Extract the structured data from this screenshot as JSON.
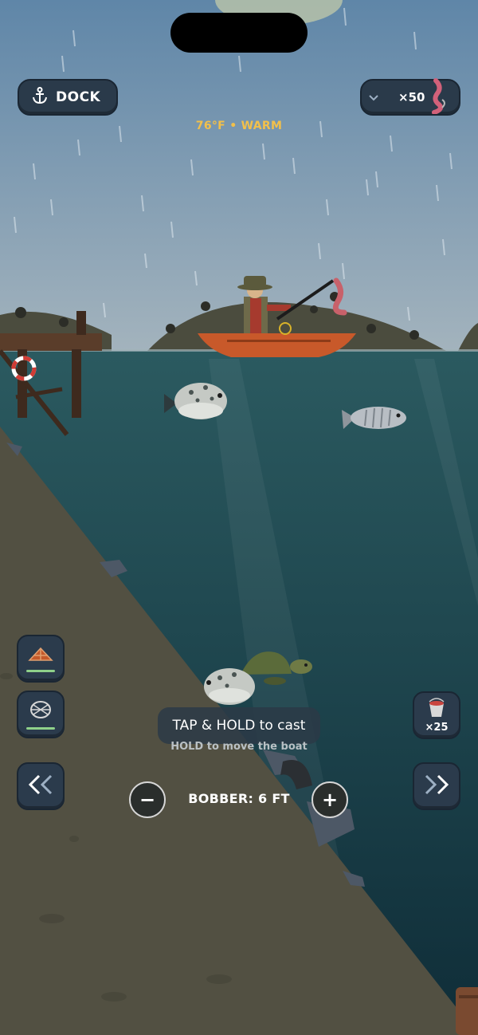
{
  "header": {
    "dock_label": "DOCK",
    "bait_count": "×50",
    "temperature": "76°F • WARM"
  },
  "tools": {
    "trap_icon": "crab-trap-icon",
    "net_icon": "fish-net-icon",
    "bucket_count": "×25"
  },
  "hints": {
    "cast": "TAP & HOLD to cast",
    "move": "HOLD to move the boat"
  },
  "bobber": {
    "label": "BOBBER: 6 FT",
    "minus": "−",
    "plus": "+"
  },
  "colors": {
    "sky_top": "#5f86a8",
    "sky_bottom": "#9fb1bd",
    "water": "#1f4a52",
    "seabed": "#525042",
    "boat": "#c8592a",
    "accent_text": "#f2c04a"
  }
}
